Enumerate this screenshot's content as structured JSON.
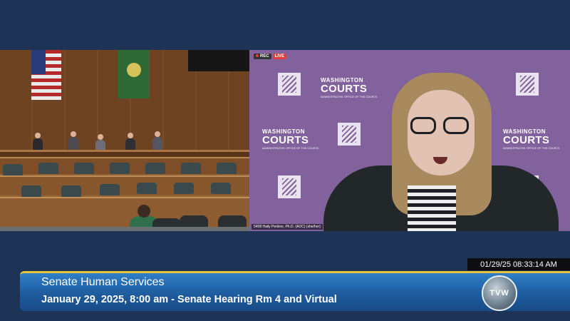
{
  "chamber_video": {
    "nameplate": ""
  },
  "zoom_video": {
    "rec_label": "REC",
    "live_label": "LIVE",
    "logo_line1": "WASHINGTON",
    "logo_line2": "COURTS",
    "logo_line3": "ADMINISTRATIVE OFFICE OF THE COURTS",
    "participant_name": "5408 Haily Perkins, Ph.D. (AOC) (she/her)"
  },
  "overlay": {
    "timestamp": "01/29/25 08:33:14 AM",
    "title": "Senate Human Services",
    "subtitle": "January 29, 2025, 8:00 am - Senate Hearing Rm 4 and Virtual",
    "network_logo": "TVW"
  },
  "colors": {
    "background": "#1e3456",
    "lower_third": "#1f5c9f",
    "accent_line": "#e8c33c",
    "zoom_backdrop": "#82629c",
    "live": "#e23b3b"
  }
}
